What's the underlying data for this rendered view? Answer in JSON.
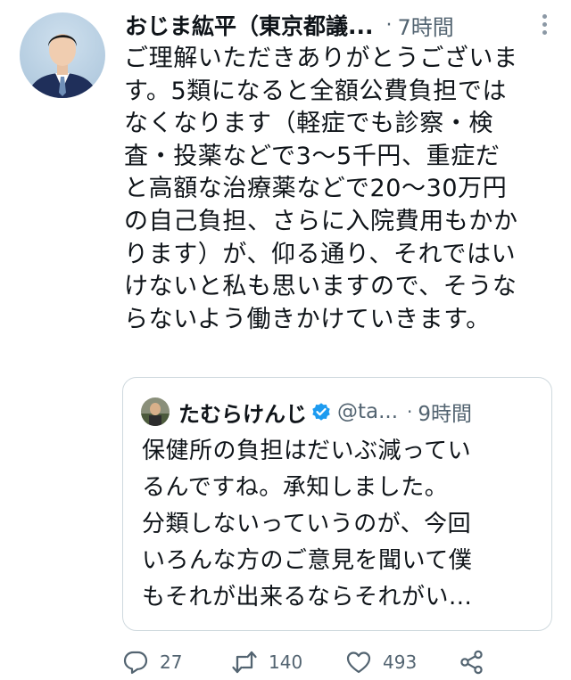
{
  "tweet": {
    "author_name": "おじま紘平（東京都議...",
    "separator": "·",
    "time": "7時間",
    "text_lines": [
      "ご理解いただきありがとうございま",
      "す。5類になると全額公費負担では",
      "なくなります（軽症でも診察・検",
      "査・投薬などで3〜5千円、重症だ",
      "と高額な治療薬などで20〜30万円",
      "の自己負担、さらに入院費用もかか",
      "ります）が、仰る通り、それではい",
      "けないと私も思いますので、そうな",
      "らないよう働きかけていきます。"
    ]
  },
  "quoted": {
    "author_name": "たむらけんじ",
    "handle": "@ta...",
    "separator": "·",
    "time": "9時間",
    "text_lines": [
      "保健所の負担はだいぶ減ってい",
      "るんですね。承知しました。",
      "分類しないっていうのが、今回",
      "いろんな方のご意見を聞いて僕",
      "もそれが出来るならそれがい..."
    ]
  },
  "actions": {
    "reply_count": "27",
    "retweet_count": "140",
    "like_count": "493",
    "icons": [
      "reply-icon",
      "retweet-icon",
      "like-icon",
      "share-icon"
    ]
  },
  "colors": {
    "text": "#0f1419",
    "secondary": "#536471",
    "verified": "#1d9bf0",
    "border": "#cfd9de"
  }
}
